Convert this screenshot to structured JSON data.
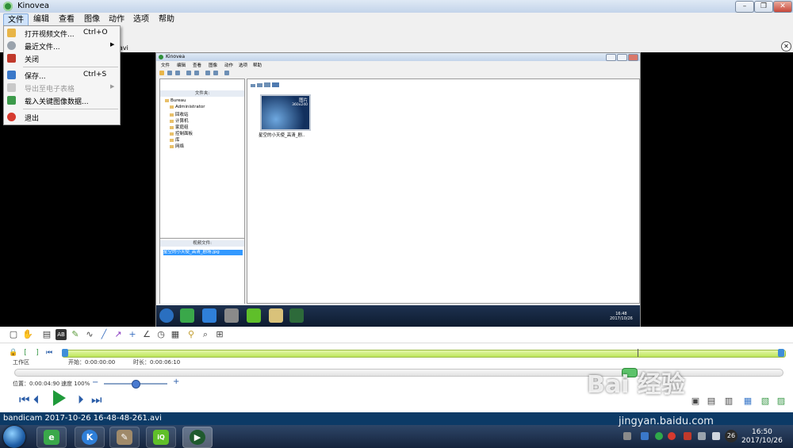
{
  "app": {
    "title": "Kinovea"
  },
  "menu": [
    "文件",
    "编辑",
    "查看",
    "图像",
    "动作",
    "选项",
    "帮助"
  ],
  "file_menu": [
    {
      "label": "打开视频文件...",
      "shortcut": "Ctrl+O"
    },
    {
      "label": "最近文件..."
    },
    {
      "label": "关闭"
    },
    {
      "label": "保存...",
      "shortcut": "Ctrl+S"
    },
    {
      "label": "导出至电子表格"
    },
    {
      "label": "载入关键图像数据..."
    },
    {
      "label": "退出"
    }
  ],
  "tab": {
    "filename": "avi"
  },
  "embedded": {
    "title": "Kinovea",
    "menu": [
      "文件",
      "编辑",
      "查看",
      "图像",
      "动作",
      "选项",
      "帮助"
    ],
    "folders_header": "文件夹:",
    "tree": [
      "Bureau",
      "Administrator",
      "回收站",
      "计算机",
      "家庭组",
      "控制面板",
      "库",
      "网络"
    ],
    "files_header": "视频文件:",
    "selected_file": "星空的小天使_高清_剧场.jpg",
    "thumb_tag": "图片",
    "thumb_size": "360x240",
    "thumb_label": "星空的小天使_高清_剧..",
    "clock_time": "16:48",
    "clock_date": "2017/10/26"
  },
  "workspace": {
    "label": "工作区",
    "start": "开始：0:00:00:00",
    "duration": "时长：0:00:06:10",
    "position": "位置：0:00:04:90",
    "speed": "速度 100%",
    "playback_fraction": 0.8,
    "speed_fraction": 0.5
  },
  "status": {
    "text": "bandicam 2017-10-26 16-48-48-261.avi"
  },
  "taskbar": {
    "time": "16:50",
    "date": "2017/10/26",
    "badge": "26"
  },
  "watermark": {
    "brand": "Bai 经验",
    "url": "jingyan.baidu.com"
  },
  "colors": {
    "timeline": "#bde65a",
    "play": "#1f9a3a",
    "statusbar": "#0c3a66",
    "menu_highlight": "#cfe3fb"
  }
}
